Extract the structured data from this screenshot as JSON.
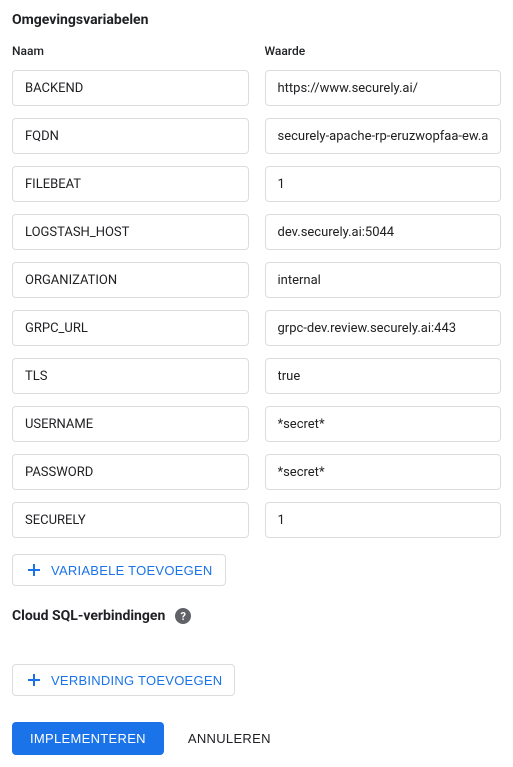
{
  "env_vars": {
    "title": "Omgevingsvariabelen",
    "name_header": "Naam",
    "value_header": "Waarde",
    "rows": [
      {
        "name": "BACKEND",
        "value": "https://www.securely.ai/"
      },
      {
        "name": "FQDN",
        "value": "securely-apache-rp-eruzwopfaa-ew.a.run.app"
      },
      {
        "name": "FILEBEAT",
        "value": "1"
      },
      {
        "name": "LOGSTASH_HOST",
        "value": "dev.securely.ai:5044"
      },
      {
        "name": "ORGANIZATION",
        "value": "internal"
      },
      {
        "name": "GRPC_URL",
        "value": "grpc-dev.review.securely.ai:443"
      },
      {
        "name": "TLS",
        "value": "true"
      },
      {
        "name": "USERNAME",
        "value": "*secret*"
      },
      {
        "name": "PASSWORD",
        "value": "*secret*"
      },
      {
        "name": "SECURELY",
        "value": "1"
      }
    ],
    "add_button": "VARIABELE TOEVOEGEN"
  },
  "cloud_sql": {
    "title": "Cloud SQL-verbindingen",
    "help": "?",
    "add_button": "VERBINDING TOEVOEGEN"
  },
  "actions": {
    "implement": "IMPLEMENTEREN",
    "cancel": "ANNULEREN"
  }
}
